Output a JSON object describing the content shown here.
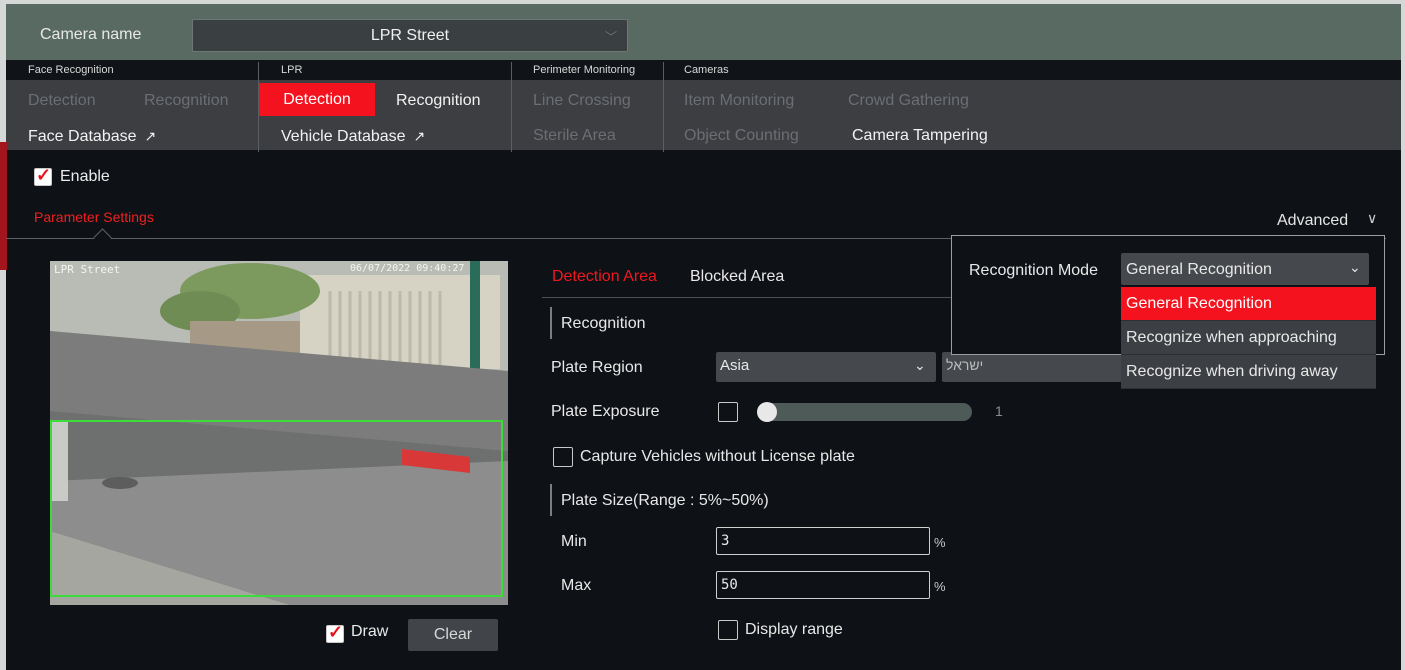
{
  "camera": {
    "label": "Camera name",
    "value": "LPR Street"
  },
  "categories": {
    "face": "Face Recognition",
    "lpr": "LPR",
    "perimeter": "Perimeter Monitoring",
    "cameras": "Cameras"
  },
  "tabs": {
    "face_detection": "Detection",
    "face_recognition": "Recognition",
    "face_database": "Face Database",
    "lpr_detection": "Detection",
    "lpr_recognition": "Recognition",
    "vehicle_database": "Vehicle Database",
    "line_crossing": "Line Crossing",
    "sterile_area": "Sterile Area",
    "item_monitoring": "Item Monitoring",
    "object_counting": "Object Counting",
    "crowd_gathering": "Crowd Gathering",
    "camera_tampering": "Camera Tampering",
    "external_arrow": "↗"
  },
  "enable": {
    "label": "Enable",
    "checked": true
  },
  "parameter_settings": "Parameter Settings",
  "advanced": {
    "label": "Advanced",
    "chevron": "∨"
  },
  "preview": {
    "osd_name": "LPR Street",
    "osd_time": "06/07/2022 09:40:27",
    "draw_label": "Draw",
    "draw_checked": true,
    "clear_label": "Clear"
  },
  "area_tabs": {
    "detection": "Detection Area",
    "blocked": "Blocked Area"
  },
  "recognition": {
    "section": "Recognition",
    "plate_region_label": "Plate Region",
    "plate_region_value": "Asia",
    "country_value": "ישראל",
    "plate_exposure_label": "Plate Exposure",
    "plate_exposure_value": "1",
    "capture_label": "Capture Vehicles without License plate"
  },
  "plate_size": {
    "section": "Plate Size(Range : 5%~50%)",
    "min_label": "Min",
    "min_value": "3",
    "max_label": "Max",
    "max_value": "50",
    "unit": "%",
    "display_range_label": "Display range"
  },
  "recognition_mode": {
    "label": "Recognition Mode",
    "value": "General Recognition",
    "options": [
      "General Recognition",
      "Recognize when approaching",
      "Recognize when driving away"
    ]
  },
  "colors": {
    "accent": "#f5121f",
    "panel": "#3c3e41",
    "background": "#0e1116",
    "header": "#586a62",
    "detection_box": "#3ddc3a"
  }
}
